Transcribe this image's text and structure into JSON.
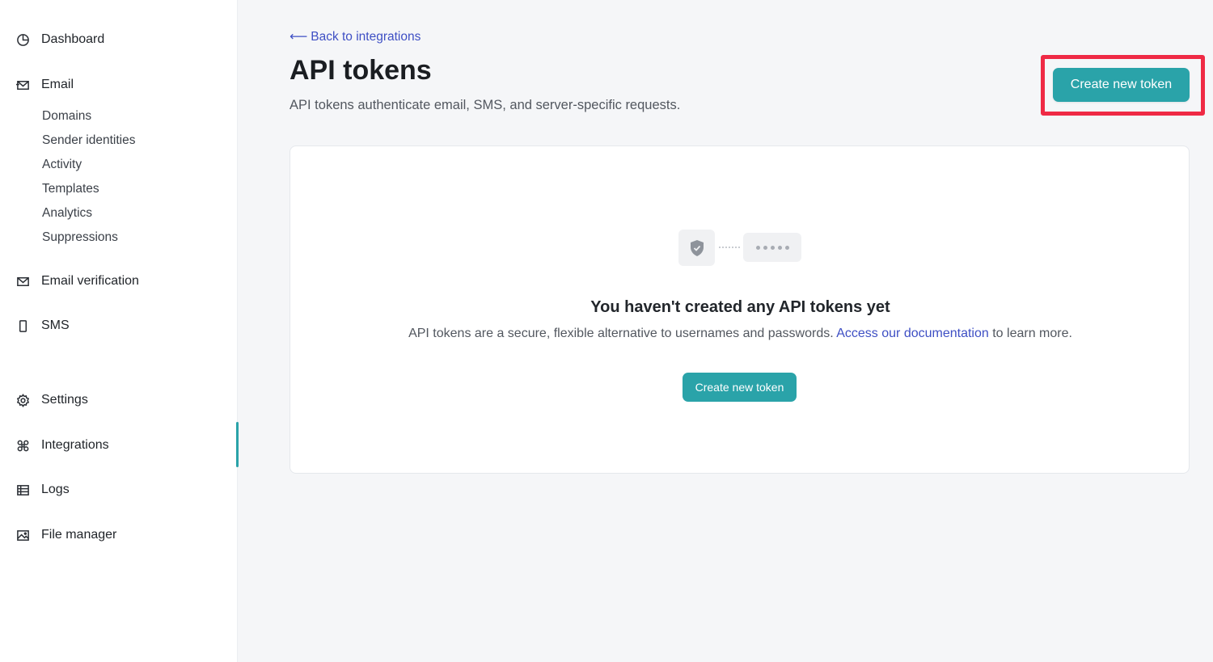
{
  "sidebar": {
    "dashboard": {
      "label": "Dashboard",
      "icon": "pie-chart-icon"
    },
    "email": {
      "label": "Email",
      "icon": "mail-send-icon"
    },
    "email_sub": [
      "Domains",
      "Sender identities",
      "Activity",
      "Templates",
      "Analytics",
      "Suppressions"
    ],
    "email_verification": {
      "label": "Email verification",
      "icon": "mail-check-icon"
    },
    "sms": {
      "label": "SMS",
      "icon": "phone-icon"
    },
    "settings": {
      "label": "Settings",
      "icon": "gear-icon"
    },
    "integrations": {
      "label": "Integrations",
      "icon": "command-icon",
      "active": true
    },
    "logs": {
      "label": "Logs",
      "icon": "table-icon"
    },
    "file_manager": {
      "label": "File manager",
      "icon": "image-icon"
    }
  },
  "header": {
    "back_link": "Back to integrations",
    "back_arrow": "⟵",
    "title": "API tokens",
    "subtitle": "API tokens authenticate email, SMS, and server-specific requests.",
    "create_button": "Create new token"
  },
  "empty_state": {
    "title": "You haven't created any API tokens yet",
    "desc_before": "API tokens are a secure, flexible alternative to usernames and passwords. ",
    "link": "Access our documentation",
    "desc_after": " to learn more.",
    "button": "Create new token"
  },
  "colors": {
    "accent": "#2aa3a9",
    "link": "#3e4fc4",
    "highlight": "#ef2a45"
  }
}
